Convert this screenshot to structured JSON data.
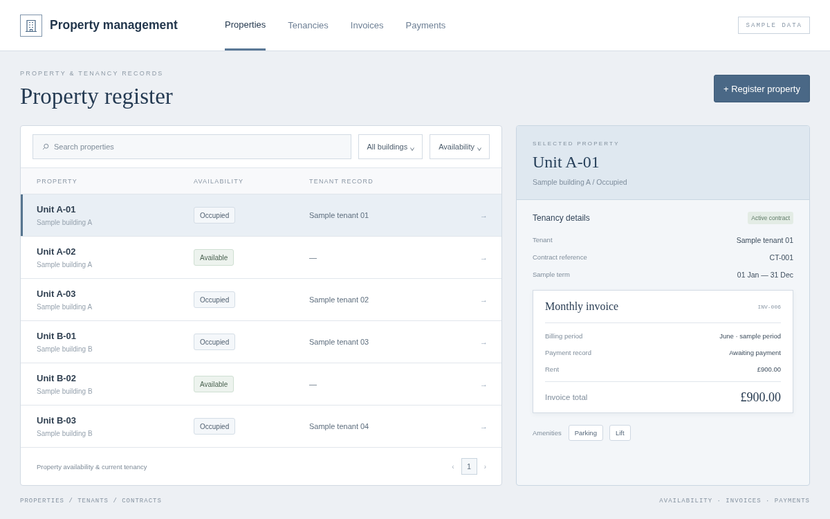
{
  "header": {
    "brand": "Property management",
    "nav": [
      {
        "label": "Properties",
        "selected": true
      },
      {
        "label": "Tenancies",
        "selected": false
      },
      {
        "label": "Invoices",
        "selected": false
      },
      {
        "label": "Payments",
        "selected": false
      }
    ],
    "tag": "SAMPLE DATA"
  },
  "page": {
    "eyebrow": "PROPERTY & TENANCY RECORDS",
    "title": "Property register",
    "action": "+ Register property"
  },
  "register": {
    "search": {
      "placeholder": "Search properties"
    },
    "filters": [
      "All buildings",
      "Availability"
    ],
    "columns": [
      "PROPERTY",
      "AVAILABILITY",
      "TENANT RECORD"
    ],
    "rows": [
      {
        "unit": "Unit A-01",
        "building": "Sample building A",
        "availability": {
          "label": "Occupied",
          "kind": "occupied"
        },
        "tenant": "Sample tenant 01",
        "arrow": "→",
        "selected": true
      },
      {
        "unit": "Unit A-02",
        "building": "Sample building A",
        "availability": {
          "label": "Available",
          "kind": "available"
        },
        "tenant": "—",
        "arrow": "→",
        "selected": false
      },
      {
        "unit": "Unit A-03",
        "building": "Sample building A",
        "availability": {
          "label": "Occupied",
          "kind": "occupied"
        },
        "tenant": "Sample tenant 02",
        "arrow": "→",
        "selected": false
      },
      {
        "unit": "Unit B-01",
        "building": "Sample building B",
        "availability": {
          "label": "Occupied",
          "kind": "occupied"
        },
        "tenant": "Sample tenant 03",
        "arrow": "→",
        "selected": false
      },
      {
        "unit": "Unit B-02",
        "building": "Sample building B",
        "availability": {
          "label": "Available",
          "kind": "available"
        },
        "tenant": "—",
        "arrow": "→",
        "selected": false
      },
      {
        "unit": "Unit B-03",
        "building": "Sample building B",
        "availability": {
          "label": "Occupied",
          "kind": "occupied"
        },
        "tenant": "Sample tenant 04",
        "arrow": "→",
        "selected": false
      }
    ],
    "caption": "Property availability & current tenancy",
    "pagination": {
      "previous": "‹",
      "pages": [
        {
          "label": "1",
          "selected": true
        }
      ],
      "next": "›"
    }
  },
  "detail": {
    "eyebrow": "SELECTED PROPERTY",
    "title": "Unit A-01",
    "subtitle": "Sample building A / Occupied",
    "section_title": "Tenancy details",
    "badge": "Active contract",
    "fields": [
      {
        "label": "Tenant",
        "value": "Sample tenant 01"
      },
      {
        "label": "Contract reference",
        "value": "CT-001"
      },
      {
        "label": "Sample term",
        "value": "01 Jan — 31 Dec"
      }
    ],
    "invoice": {
      "title": "Monthly invoice",
      "number": "INV-006",
      "lines": [
        {
          "label": "Billing period",
          "value": "June · sample period"
        },
        {
          "label": "Payment record",
          "value": "Awaiting payment"
        },
        {
          "label": "Rent",
          "value": "£900.00"
        }
      ],
      "total_label": "Invoice total",
      "total": "£900.00"
    },
    "amenities": {
      "label": "Amenities",
      "items": [
        "Parking",
        "Lift"
      ]
    }
  },
  "footer": {
    "left": "PROPERTIES / TENANTS / CONTRACTS",
    "right": "AVAILABILITY · INVOICES · PAYMENTS"
  }
}
